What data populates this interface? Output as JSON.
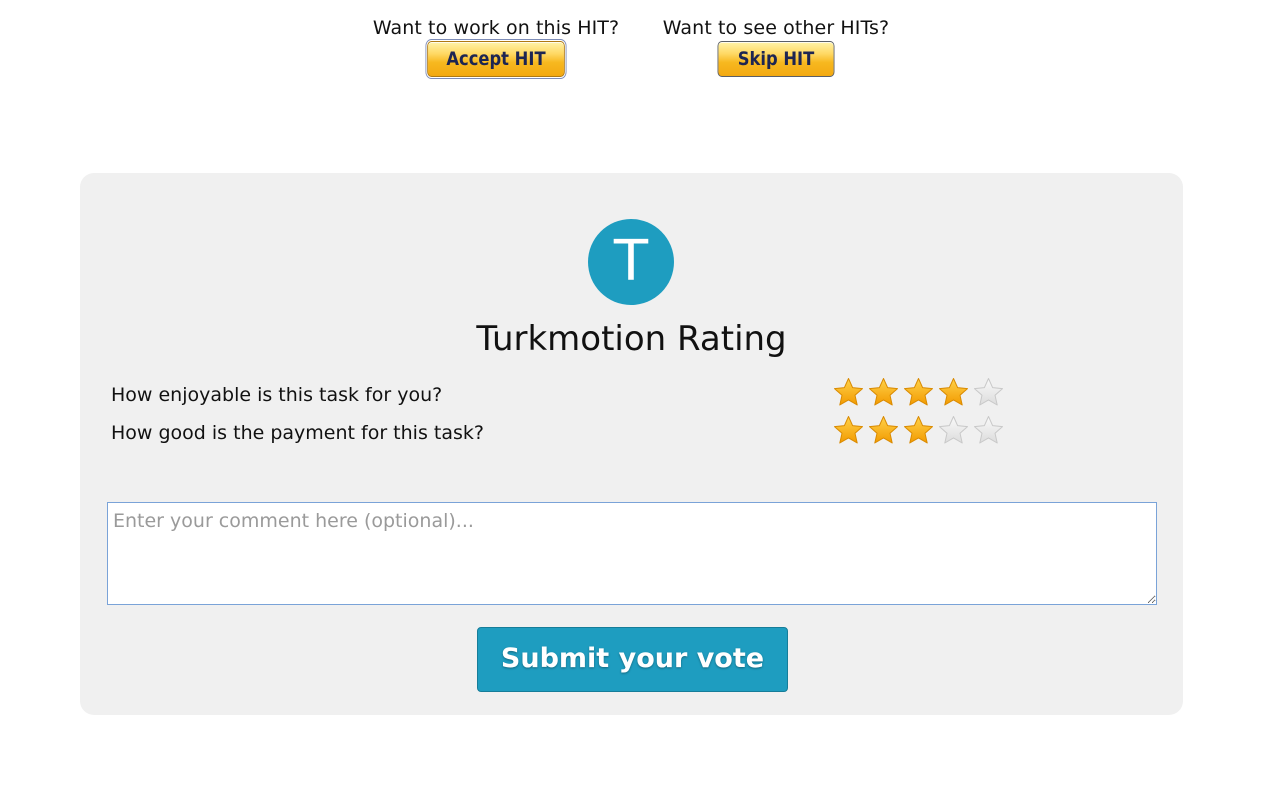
{
  "hit_bar": {
    "accept_prompt": "Want to work on this HIT?",
    "accept_label": "Accept HIT",
    "skip_prompt": "Want to see other HITs?",
    "skip_label": "Skip HIT"
  },
  "panel": {
    "logo_letter": "T",
    "title": "Turkmotion Rating",
    "questions": [
      {
        "text": "How enjoyable is this task for you?",
        "rating": 4,
        "max": 5
      },
      {
        "text": "How good is the payment for this task?",
        "rating": 3,
        "max": 5
      }
    ],
    "comment_placeholder": "Enter your comment here (optional)...",
    "submit_label": "Submit your vote"
  },
  "colors": {
    "accent": "#1e9dc0",
    "panel_bg": "#f0f0f0",
    "star_filled": "#f5a500",
    "star_empty": "#e6e6e6"
  },
  "icons": {
    "logo": "t-letter-circle-icon",
    "rating": "star-icon"
  }
}
